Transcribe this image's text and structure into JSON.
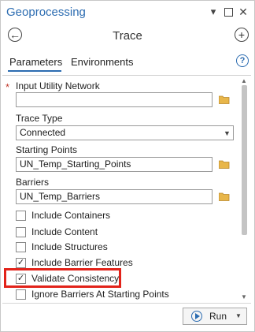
{
  "window": {
    "title": "Geoprocessing",
    "tool_title": "Trace"
  },
  "tabs": [
    {
      "label": "Parameters",
      "active": true
    },
    {
      "label": "Environments",
      "active": false
    }
  ],
  "params": {
    "input_network": {
      "label": "Input Utility Network",
      "required_marker": "*",
      "value": ""
    },
    "trace_type": {
      "label": "Trace Type",
      "value": "Connected"
    },
    "starting_points": {
      "label": "Starting Points",
      "value": "UN_Temp_Starting_Points"
    },
    "barriers": {
      "label": "Barriers",
      "value": "UN_Temp_Barriers"
    }
  },
  "checkboxes": [
    {
      "label": "Include Containers",
      "checked": false
    },
    {
      "label": "Include Content",
      "checked": false
    },
    {
      "label": "Include Structures",
      "checked": false
    },
    {
      "label": "Include Barrier Features",
      "checked": true
    },
    {
      "label": "Validate Consistency",
      "checked": true
    },
    {
      "label": "Ignore Barriers At Starting Points",
      "checked": false
    }
  ],
  "footer": {
    "run_label": "Run"
  },
  "colors": {
    "accent": "#2c6cb1",
    "highlight": "#e2231a",
    "required": "#c0392b"
  }
}
